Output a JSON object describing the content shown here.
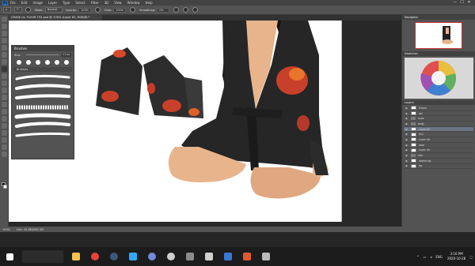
{
  "app": {
    "logo_text": "Ps",
    "menu": [
      "File",
      "Edit",
      "Image",
      "Layer",
      "Type",
      "Select",
      "Filter",
      "3D",
      "View",
      "Window",
      "Help"
    ],
    "window_controls": [
      "—",
      "☐",
      "✕"
    ],
    "document_tab": "CHASE LIL FLOOR TS4.psd @ 100% (Layer 62, RGB/8) *",
    "accent": "#2a6fb5"
  },
  "options_bar": {
    "mode_label": "Mode:",
    "mode_value": "Normal",
    "opacity_label": "Opacity:",
    "opacity_value": "100%",
    "flow_label": "Flow:",
    "flow_value": "100%",
    "smoothing_label": "Smoothing:",
    "smoothing_value": "0%"
  },
  "brush_panel": {
    "title": "Brushes",
    "size_label": "Size:",
    "size_value": "11 px",
    "folder_label": "Brushes"
  },
  "right_panels": {
    "navigator_title": "Navigator",
    "swatches_title": "Swatches",
    "layers_title": "Layers",
    "layers": [
      {
        "name": "Frame",
        "type": "layer"
      },
      {
        "name": "tail",
        "type": "layer"
      },
      {
        "name": "eyes",
        "type": "folder"
      },
      {
        "name": "body",
        "type": "folder"
      },
      {
        "name": "Layer 62",
        "type": "layer",
        "selected": true
      },
      {
        "name": "tiny",
        "type": "layer"
      },
      {
        "name": "Layer 58",
        "type": "layer"
      },
      {
        "name": "robe",
        "type": "layer"
      },
      {
        "name": "Layer 59",
        "type": "layer"
      },
      {
        "name": "skin",
        "type": "folder"
      },
      {
        "name": "sketch bg",
        "type": "layer"
      },
      {
        "name": "bg",
        "type": "layer"
      }
    ]
  },
  "status_bar": {
    "zoom": "100%",
    "doc_info": "Doc: 45.8M/265.5M"
  },
  "taskbar": {
    "clock_time": "3:16 PM",
    "clock_date": "2020-10-28",
    "lang": "ENG",
    "apps": [
      {
        "name": "file-explorer",
        "color": "#f2c14e"
      },
      {
        "name": "chrome",
        "color": "#e94235"
      },
      {
        "name": "steam",
        "color": "#1b2838"
      },
      {
        "name": "photoshop",
        "color": "#31a8ff"
      },
      {
        "name": "discord",
        "color": "#7289da"
      },
      {
        "name": "obs",
        "color": "#cfcfcf"
      },
      {
        "name": "settings",
        "color": "#8a8a8a"
      },
      {
        "name": "clip",
        "color": "#d0d0d0"
      },
      {
        "name": "mail",
        "color": "#3b78d6"
      },
      {
        "name": "media",
        "color": "#e05a2a"
      },
      {
        "name": "store",
        "color": "#bbbbbb"
      }
    ]
  },
  "colors": {
    "robe": "#262626",
    "flower_red": "#c8402a",
    "flower_orange": "#e8762a",
    "skin": "#e8b48c",
    "hair": "#111111"
  }
}
